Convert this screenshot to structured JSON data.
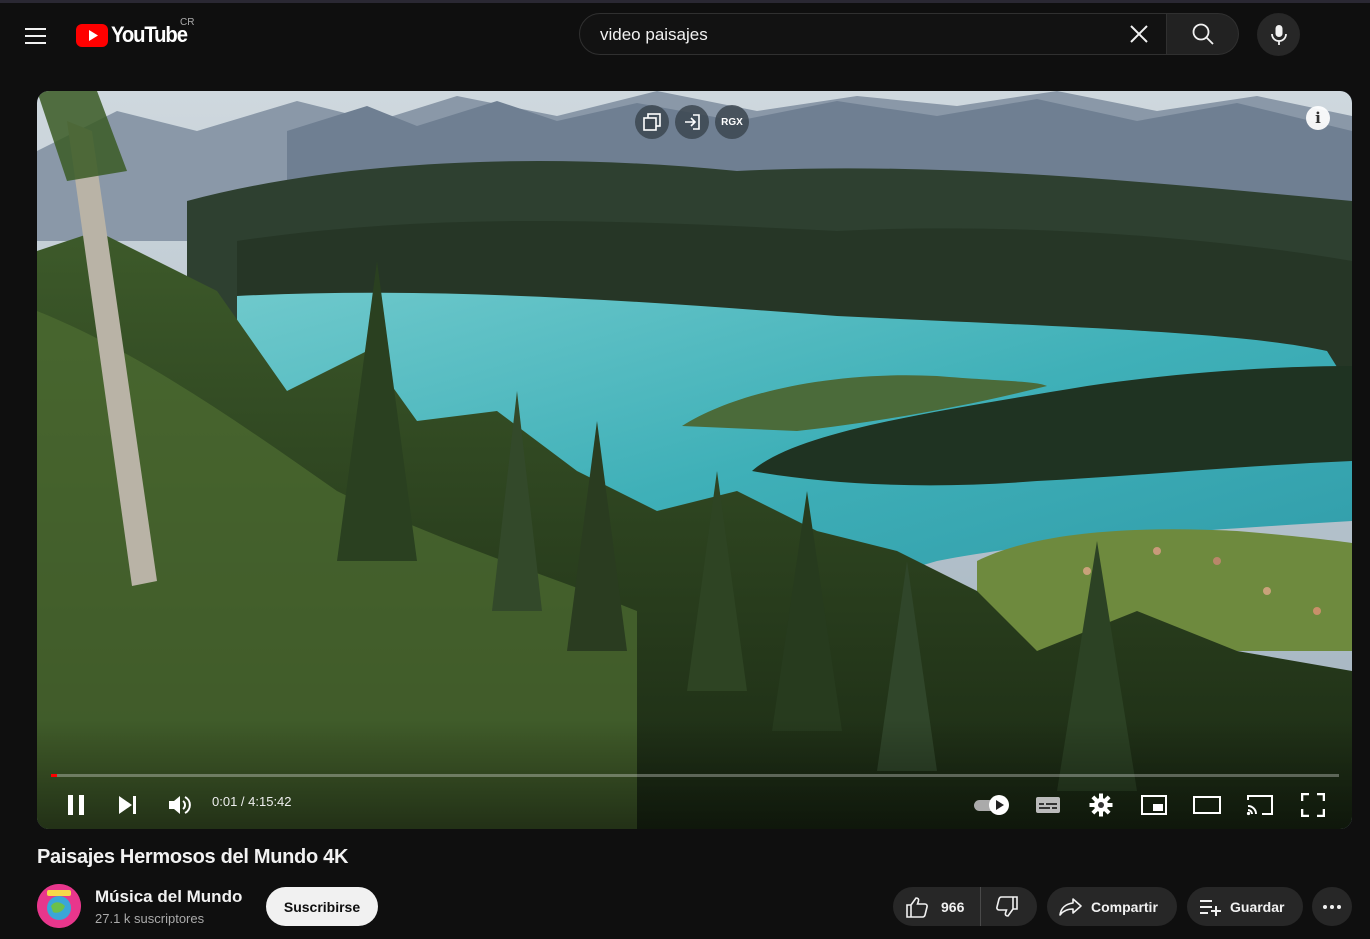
{
  "masthead": {
    "logo_text": "YouTube",
    "country_code": "CR",
    "search_value": "video paisajes"
  },
  "player": {
    "overlay_buttons": [
      "picture-copy",
      "enter",
      "RGX"
    ],
    "rgx_label": "RGX",
    "progress": 0.0001,
    "time": "0:01 / 4:15:42",
    "autoplay_on": true
  },
  "video": {
    "title": "Paisajes Hermosos del Mundo 4K"
  },
  "channel": {
    "name": "Música del Mundo",
    "subscribers": "27.1 k suscriptores",
    "subscribe_label": "Suscribirse"
  },
  "actions": {
    "likes": "966",
    "share_label": "Compartir",
    "save_label": "Guardar"
  },
  "colors": {
    "background": "#0f0f0f",
    "brand_red": "#ff0000",
    "pill_bg": "#272727"
  }
}
